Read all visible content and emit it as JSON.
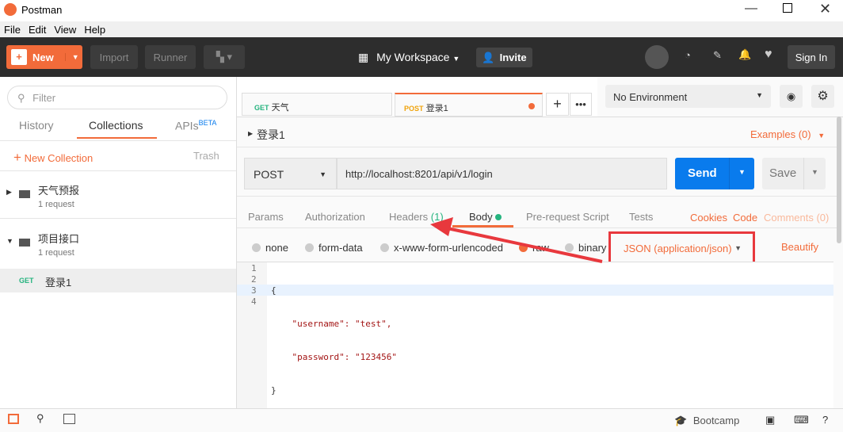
{
  "window": {
    "title": "Postman"
  },
  "menu": [
    "File",
    "Edit",
    "View",
    "Help"
  ],
  "toolbar": {
    "new": "New",
    "import": "Import",
    "runner": "Runner",
    "workspace": "My Workspace",
    "invite": "Invite",
    "signin": "Sign In"
  },
  "sidebar": {
    "filter_placeholder": "Filter",
    "tabs": [
      "History",
      "Collections",
      "APIs"
    ],
    "beta": "BETA",
    "new_collection": "New Collection",
    "trash": "Trash",
    "collections": [
      {
        "name": "天气预报",
        "count": "1 request"
      },
      {
        "name": "项目接口",
        "count": "1 request"
      }
    ],
    "request": {
      "method": "GET",
      "name": "登录1"
    }
  },
  "tabs": [
    {
      "method": "GET",
      "name": "天气"
    },
    {
      "method": "POST",
      "name": "登录1"
    }
  ],
  "environment": "No Environment",
  "request": {
    "title": "登录1",
    "examples": "Examples (0)",
    "method": "POST",
    "url": "http://localhost:8201/api/v1/login",
    "send": "Send",
    "save": "Save"
  },
  "req_tabs": {
    "params": "Params",
    "authorization": "Authorization",
    "headers": "Headers",
    "headers_count": "(1)",
    "body": "Body",
    "prerequest": "Pre-request Script",
    "tests": "Tests",
    "cookies": "Cookies",
    "code": "Code",
    "comments": "Comments (0)"
  },
  "body_types": {
    "none": "none",
    "form_data": "form-data",
    "urlencoded": "x-www-form-urlencoded",
    "raw": "raw",
    "binary": "binary",
    "content_type": "JSON (application/json)",
    "beautify": "Beautify"
  },
  "code_lines": [
    {
      "n": "1",
      "text": "{"
    },
    {
      "n": "2",
      "text": "    \"username\": \"test\","
    },
    {
      "n": "3",
      "text": "    \"password\": \"123456\""
    },
    {
      "n": "4",
      "text": "}"
    }
  ],
  "footer": {
    "bootcamp": "Bootcamp"
  },
  "colors": {
    "accent": "#f26b3a",
    "send": "#097bed",
    "green": "#26b47f"
  }
}
